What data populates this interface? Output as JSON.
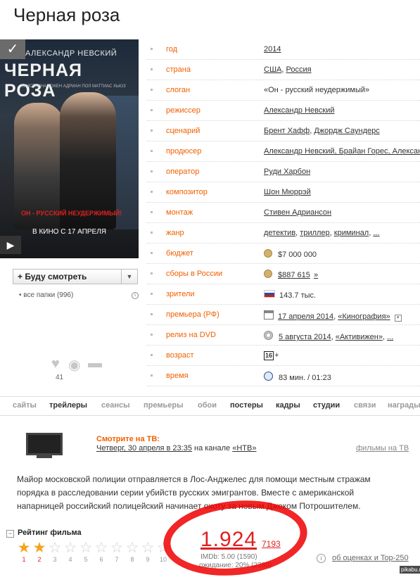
{
  "title": "Черная роза",
  "poster": {
    "director": "АЛЕКСАНДР НЕВСКИЙ",
    "title": "ЧЕРНАЯ РОЗА",
    "cast": "КРИСТАННА ЛОКЕН   АДРИАН ПОЛ   МАТТИАС ХЬЮЗ",
    "tagline": "ОН - РУССКИЙ НЕУДЕРЖИМЫЙ!",
    "release": "В КИНО С 17 АПРЕЛЯ",
    "corner_icon": "check-icon",
    "play_icon": "play-icon"
  },
  "watch_button": {
    "label": "Буду смотреть"
  },
  "folders": "• все папки (996)",
  "likes_count": "41",
  "info": {
    "year_label": "год",
    "year": "2014",
    "country_label": "страна",
    "country1": "США",
    "country2": "Россия",
    "slogan_label": "слоган",
    "slogan": "«Он - русский неудержимый»",
    "director_label": "режиссер",
    "director": "Александр Невский",
    "script_label": "сценарий",
    "script1": "Брент Хафф",
    "script2": "Джордж Саундерс",
    "producer_label": "продюсер",
    "producer": "Александр Невский, Брайан Горес, Алексан",
    "operator_label": "оператор",
    "operator": "Руди Харбон",
    "composer_label": "композитор",
    "composer": "Шон Мюррэй",
    "montage_label": "монтаж",
    "montage": "Стивен Адриансон",
    "genre_label": "жанр",
    "genre1": "детектив",
    "genre2": "триллер",
    "genre3": "криминал",
    "genre_more": "...",
    "budget_label": "бюджет",
    "budget": "$7 000 000",
    "boxoffice_label": "сборы в России",
    "boxoffice": "$887 615",
    "boxoffice_more": "»",
    "viewers_label": "зрители",
    "viewers": "143.7 тыс.",
    "premiere_label": "премьера (РФ)",
    "premiere_date": "17 апреля 2014",
    "premiere_dist": "«Кинография»",
    "dvd_label": "релиз на DVD",
    "dvd_date": "5 августа 2014",
    "dvd_dist": "«Активижен»",
    "dvd_more": "...",
    "age_label": "возраст",
    "age": "16",
    "time_label": "время",
    "time": "83 мин. / 01:23"
  },
  "tabs": [
    "сайты",
    "трейлеры",
    "сеансы",
    "премьеры",
    "обои",
    "постеры",
    "кадры",
    "студии",
    "связи",
    "награды"
  ],
  "tv": {
    "title": "Смотрите на ТВ:",
    "when": "Четверг, 30 апреля в 23:35",
    "channel_prefix": " на канале ",
    "channel": "«НТВ»",
    "films_link": "фильмы на ТВ"
  },
  "description": "Майор московской полиции отправляется в Лос-Анджелес для помощи местным стражам порядка в расследовании серии убийств русских эмигрантов. Вместе с американской напарницей российский полицейский начинает охоту за новым Джеком Потрошителем.",
  "rating": {
    "header": "Рейтинг фильма",
    "value": "1.924",
    "votes": "7193",
    "imdb": "IMDb: 5.00 (1590)",
    "awaiting": "ожидание: 20% (2280)",
    "more_link": "об оценках и Top-250",
    "stars_filled": 2,
    "star_numbers": [
      "1",
      "2",
      "3",
      "4",
      "5",
      "6",
      "7",
      "8",
      "9",
      "10"
    ]
  },
  "watermark": "pikabu.ru"
}
